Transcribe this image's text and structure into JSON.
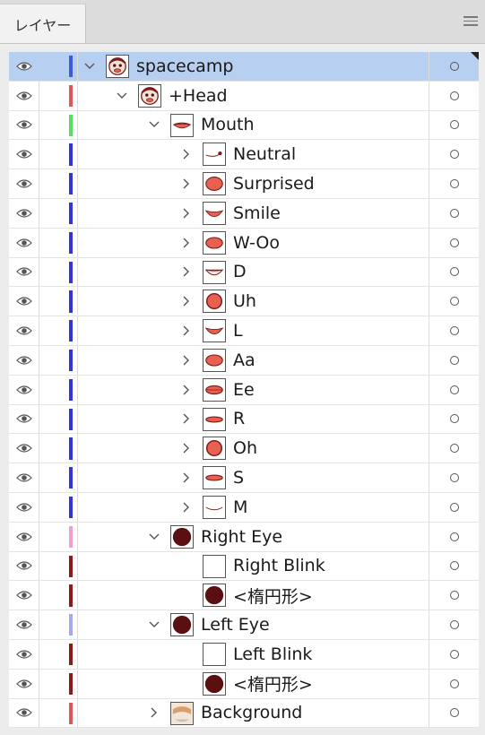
{
  "panel": {
    "tab_label": "レイヤー",
    "menu_icon": "hamburger-menu-icon"
  },
  "layers": [
    {
      "name": "spacecamp",
      "level": 0,
      "expandable": true,
      "expanded": true,
      "color": "#3b5bdb",
      "thumb": "head",
      "selected": true
    },
    {
      "name": "+Head",
      "level": 1,
      "expandable": true,
      "expanded": true,
      "color": "#e05555",
      "thumb": "head"
    },
    {
      "name": "Mouth",
      "level": 2,
      "expandable": true,
      "expanded": true,
      "color": "#55dd66",
      "thumb": "mouth-closed"
    },
    {
      "name": "Neutral",
      "level": 3,
      "expandable": true,
      "expanded": false,
      "color": "#3333dd",
      "thumb": "neutral"
    },
    {
      "name": "Surprised",
      "level": 3,
      "expandable": true,
      "expanded": false,
      "color": "#3333dd",
      "thumb": "oval-big"
    },
    {
      "name": "Smile",
      "level": 3,
      "expandable": true,
      "expanded": false,
      "color": "#3333dd",
      "thumb": "smile"
    },
    {
      "name": "W-Oo",
      "level": 3,
      "expandable": true,
      "expanded": false,
      "color": "#3333dd",
      "thumb": "oval-mid"
    },
    {
      "name": "D",
      "level": 3,
      "expandable": true,
      "expanded": false,
      "color": "#3333dd",
      "thumb": "smile-line"
    },
    {
      "name": "Uh",
      "level": 3,
      "expandable": true,
      "expanded": false,
      "color": "#3333dd",
      "thumb": "circle"
    },
    {
      "name": "L",
      "level": 3,
      "expandable": true,
      "expanded": false,
      "color": "#3333dd",
      "thumb": "smile"
    },
    {
      "name": "Aa",
      "level": 3,
      "expandable": true,
      "expanded": false,
      "color": "#3333dd",
      "thumb": "oval-mid"
    },
    {
      "name": "Ee",
      "level": 3,
      "expandable": true,
      "expanded": false,
      "color": "#3333dd",
      "thumb": "oval-flat"
    },
    {
      "name": "R",
      "level": 3,
      "expandable": true,
      "expanded": false,
      "color": "#3333dd",
      "thumb": "oval-thin"
    },
    {
      "name": "Oh",
      "level": 3,
      "expandable": true,
      "expanded": false,
      "color": "#3333dd",
      "thumb": "circle"
    },
    {
      "name": "S",
      "level": 3,
      "expandable": true,
      "expanded": false,
      "color": "#3333dd",
      "thumb": "oval-thin"
    },
    {
      "name": "M",
      "level": 3,
      "expandable": true,
      "expanded": false,
      "color": "#3333dd",
      "thumb": "line"
    },
    {
      "name": "Right Eye",
      "level": 2,
      "expandable": true,
      "expanded": true,
      "color": "#f0a0c8",
      "thumb": "eye"
    },
    {
      "name": "Right Blink",
      "level": 3,
      "expandable": false,
      "expanded": false,
      "color": "#8b1a1a",
      "thumb": "blank"
    },
    {
      "name": "<楕円形>",
      "level": 3,
      "expandable": false,
      "expanded": false,
      "color": "#8b1a1a",
      "thumb": "eye"
    },
    {
      "name": "Left Eye",
      "level": 2,
      "expandable": true,
      "expanded": true,
      "color": "#a8a8f0",
      "thumb": "eye"
    },
    {
      "name": "Left Blink",
      "level": 3,
      "expandable": false,
      "expanded": false,
      "color": "#8b1a1a",
      "thumb": "blank"
    },
    {
      "name": "<楕円形>",
      "level": 3,
      "expandable": false,
      "expanded": false,
      "color": "#8b1a1a",
      "thumb": "eye"
    },
    {
      "name": "Background",
      "level": 2,
      "expandable": true,
      "expanded": false,
      "color": "#e05555",
      "thumb": "background"
    }
  ]
}
